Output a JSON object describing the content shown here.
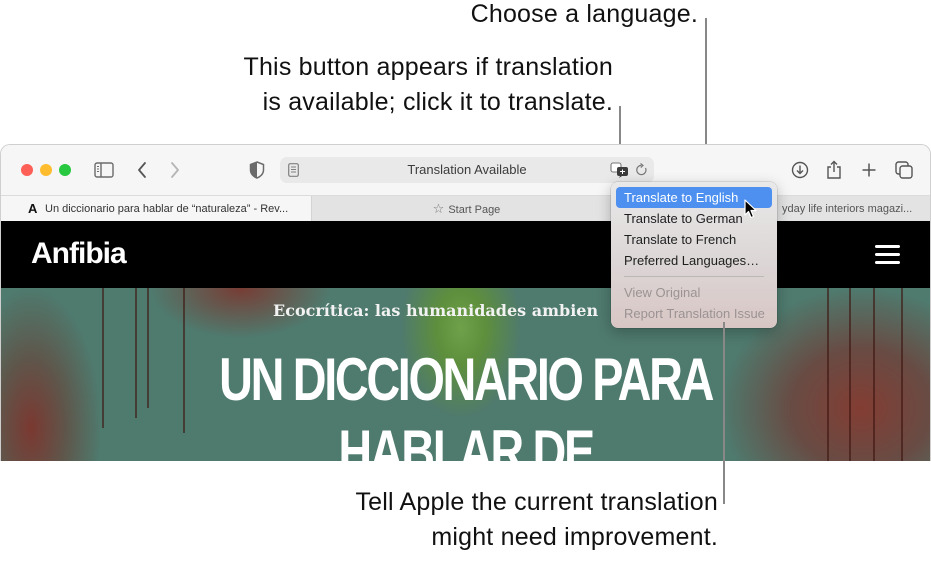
{
  "callouts": {
    "choose_language": "Choose a language.",
    "button_appears_line1": "This button appears if translation",
    "button_appears_line2": "is available; click it to translate.",
    "report_issue_line1": "Tell Apple the current translation",
    "report_issue_line2": "might need improvement."
  },
  "browser": {
    "toolbar": {
      "sidebar_icon": "sidebar-icon",
      "back_icon": "chevron-left-icon",
      "forward_icon": "chevron-right-icon",
      "privacy_icon": "shield-icon",
      "downloads_icon": "download-icon",
      "share_icon": "share-icon",
      "new_tab_icon": "plus-icon",
      "tab_overview_icon": "tab-overview-icon"
    },
    "address_bar": {
      "text": "Translation Available",
      "reader_icon": "reader-icon",
      "translate_icon": "translate-icon",
      "reload_icon": "reload-icon"
    },
    "tabs": [
      {
        "favicon": "A",
        "title": "Un diccionario para hablar de “naturaleza” - Rev...",
        "active": true
      },
      {
        "icon": "star-icon",
        "title": "Start Page",
        "active": false
      },
      {
        "title": "yday life interiors magazi...",
        "active": false
      }
    ]
  },
  "page": {
    "logo": "Anfibia",
    "menu_icon": "hamburger-icon",
    "kicker": "Ecocrítica: las humanidades ambien",
    "headline_line1": "UN DICCIONARIO PARA",
    "headline_line2": "HABLAR DE"
  },
  "translate_menu": {
    "items": [
      {
        "label": "Translate to English",
        "state": "highlighted"
      },
      {
        "label": "Translate to German",
        "state": "normal"
      },
      {
        "label": "Translate to French",
        "state": "normal"
      },
      {
        "label": "Preferred Languages…",
        "state": "normal"
      },
      {
        "label": "View Original",
        "state": "disabled"
      },
      {
        "label": "Report Translation Issue",
        "state": "disabled"
      }
    ]
  },
  "colors": {
    "menu_highlight": "#4d90f0",
    "traffic_close": "#fe5f57",
    "traffic_minimize": "#febc2e",
    "traffic_zoom": "#28c840",
    "site_header": "#000000"
  }
}
